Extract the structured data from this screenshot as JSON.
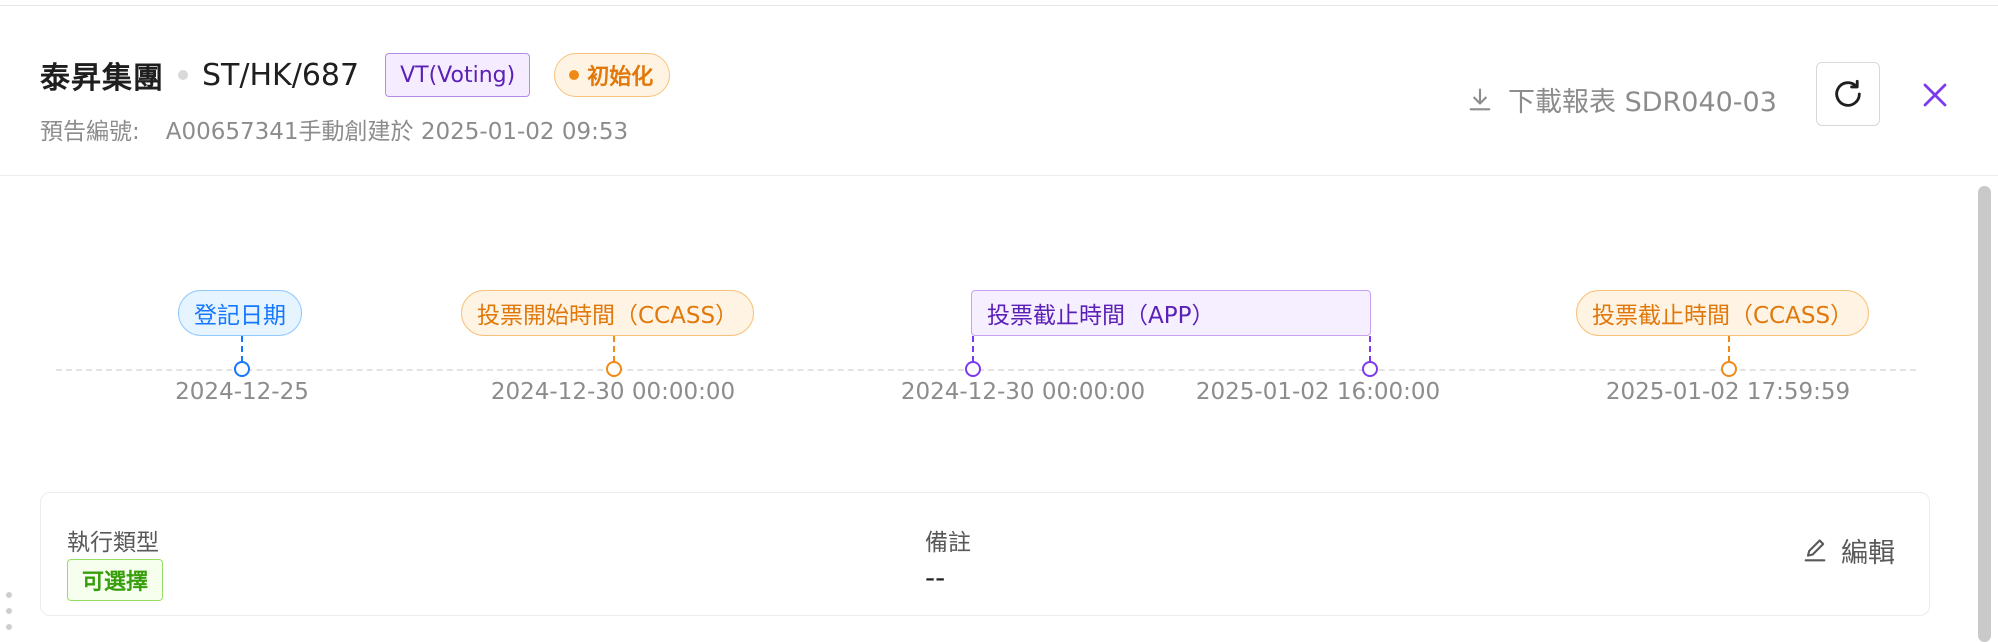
{
  "header": {
    "company": "泰昇集團",
    "code": "ST/HK/687",
    "type_tag": "VT(Voting)",
    "status_tag": "初始化",
    "sub_label": "預告編號:",
    "sub_value": "A00657341手動創建於 2025-01-02 09:53",
    "download_label": "下載報表 SDR040-03",
    "download_icon": "download-icon",
    "refresh_icon": "refresh-icon",
    "close_icon": "close-icon"
  },
  "timeline": {
    "events": [
      {
        "label": "登記日期",
        "color": "blue"
      },
      {
        "label": "投票開始時間（CCASS）",
        "color": "orange"
      },
      {
        "label": "投票截止時間（APP）",
        "color": "purple"
      },
      {
        "label": "投票截止時間（CCASS）",
        "color": "orange"
      }
    ],
    "dates": [
      "2024-12-25",
      "2024-12-30 00:00:00",
      "2024-12-30 00:00:00",
      "2025-01-02 16:00:00",
      "2025-01-02 17:59:59"
    ]
  },
  "info": {
    "exec_type_label": "執行類型",
    "exec_type_value": "可選擇",
    "remark_label": "備註",
    "remark_value": "--",
    "edit_label": "編輯",
    "edit_icon": "edit-icon"
  },
  "colors": {
    "accent_purple": "#5b21b6",
    "orange": "#e0780b",
    "blue": "#1677ff",
    "green": "#389e0d"
  }
}
